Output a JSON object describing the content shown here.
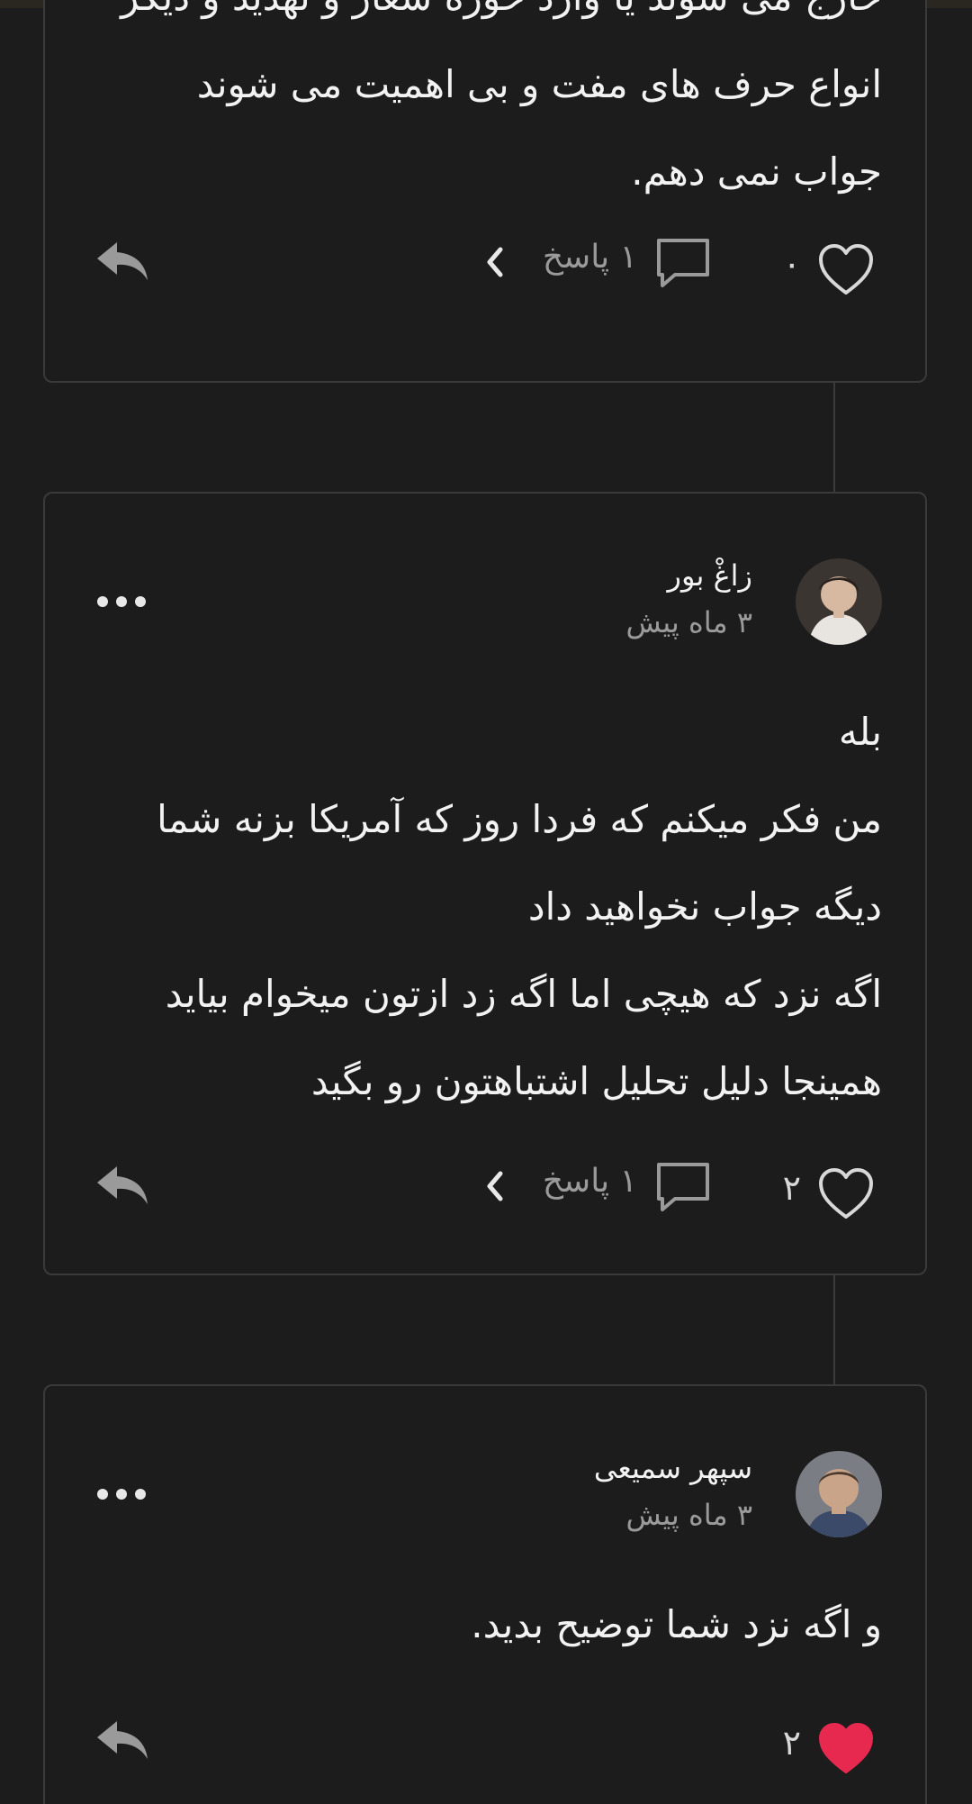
{
  "comments": [
    {
      "body_lines": [
        "خارج می شوند یا وارد حوزه شعار و تهدید و دیگر",
        "انواع حرف های مفت و بی اهمیت می شوند",
        "جواب نمی دهم."
      ],
      "like_count": "۰",
      "reply_label": "۱ پاسخ",
      "liked": false
    },
    {
      "author": "زاغْ بور",
      "time": "۳ ماه پیش",
      "body_lines": [
        "بله",
        "من فکر میکنم که فردا روز که آمریکا بزنه شما",
        "دیگه جواب نخواهید داد",
        "اگه نزد که هیچی اما اگه زد ازتون میخوام بیاید",
        "همینجا دلیل تحلیل اشتباهتون رو بگید"
      ],
      "like_count": "۲",
      "reply_label": "۱ پاسخ",
      "liked": false
    },
    {
      "author": "سپهر سمیعی",
      "time": "۳ ماه پیش",
      "body_lines": [
        "و اگه نزد شما توضیح بدید."
      ],
      "like_count": "۲",
      "liked": true
    }
  ],
  "colors": {
    "background": "#1c1c1c",
    "card_border": "#3a3a3a",
    "liked_heart": "#e8294f",
    "muted_text": "#9a9a9a"
  },
  "icons": [
    "heart-icon",
    "comment-icon",
    "chevron-left-icon",
    "reply-icon",
    "more-icon"
  ]
}
